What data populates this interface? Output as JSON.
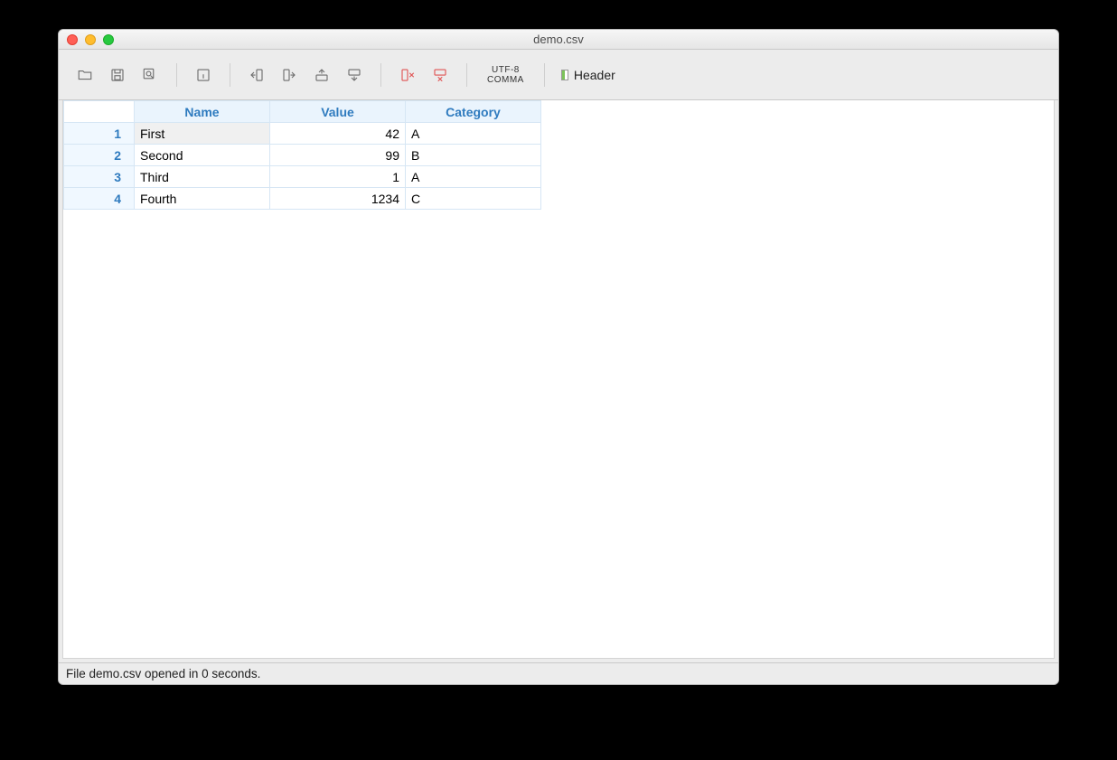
{
  "window": {
    "title": "demo.csv"
  },
  "toolbar": {
    "encoding_line1": "UTF-8",
    "encoding_line2": "COMMA",
    "header_label": "Header"
  },
  "table": {
    "columns": [
      "Name",
      "Value",
      "Category"
    ],
    "rows": [
      {
        "n": "1",
        "name": "First",
        "value": "42",
        "cat": "A"
      },
      {
        "n": "2",
        "name": "Second",
        "value": "99",
        "cat": "B"
      },
      {
        "n": "3",
        "name": "Third",
        "value": "1",
        "cat": "A"
      },
      {
        "n": "4",
        "name": "Fourth",
        "value": "1234",
        "cat": "C"
      }
    ],
    "selected_row": 0
  },
  "status": {
    "text": "File demo.csv opened in 0 seconds."
  }
}
